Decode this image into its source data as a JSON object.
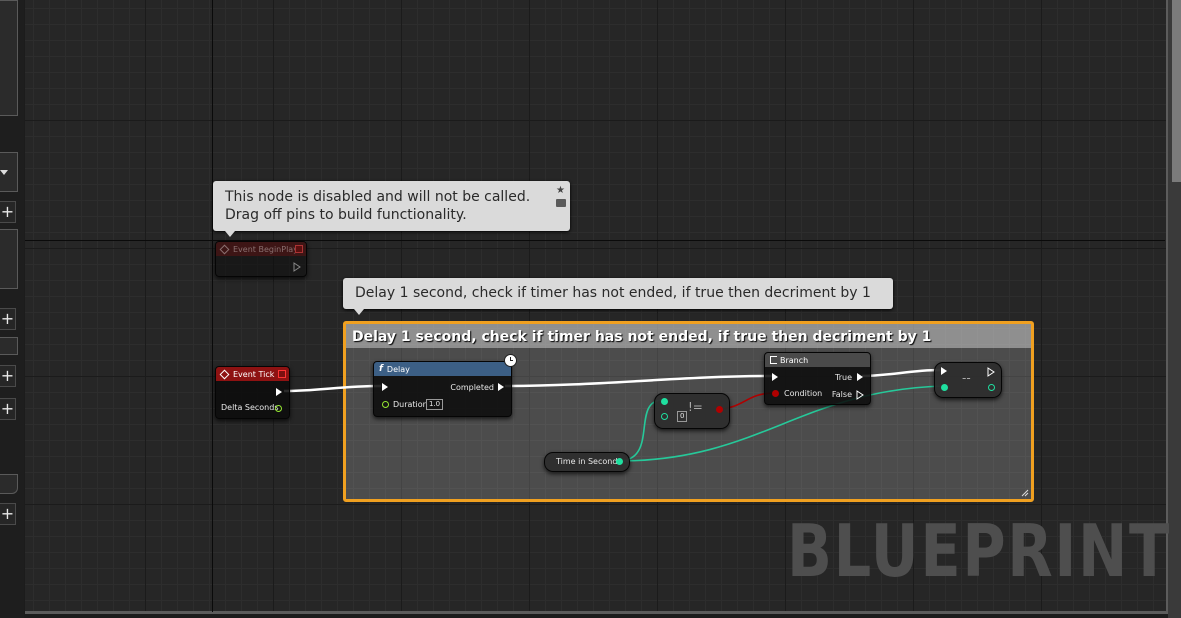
{
  "tooltips": {
    "disabled_line1": "This node is disabled and will not be called.",
    "disabled_line2": "Drag off pins to build functionality.",
    "comment_bubble": "Delay 1 second, check if timer has not ended, if true then decriment by 1"
  },
  "comment": {
    "title": "Delay 1 second, check if timer has not ended, if true then decriment by 1",
    "border_color": "#f0a020"
  },
  "nodes": {
    "begin_play": {
      "title": "Event BeginPlay"
    },
    "event_tick": {
      "title": "Event Tick",
      "output": "Delta Seconds",
      "header_color": "#8e1212"
    },
    "delay": {
      "title": "Delay",
      "output": "Completed",
      "input": "Duration",
      "duration_value": "1.0",
      "header_color": "#3c5f85"
    },
    "branch": {
      "title": "Branch",
      "condition": "Condition",
      "true_label": "True",
      "false_label": "False"
    },
    "not_equal": {
      "label": "!=",
      "value": "0"
    },
    "decrement": {
      "label": "--"
    },
    "time_var": {
      "label": "Time in Seconds"
    }
  },
  "watermark": "BLUEPRINT",
  "colors": {
    "exec": "#ffffff",
    "int_pin": "#1fe0a0",
    "bool_pin": "#a40000",
    "float_pin": "#96e832"
  },
  "icons": [
    "plus-icon",
    "chevron-down-icon",
    "clock-icon",
    "function-icon",
    "branch-icon",
    "event-icon",
    "pin-icon",
    "comment-icon"
  ]
}
